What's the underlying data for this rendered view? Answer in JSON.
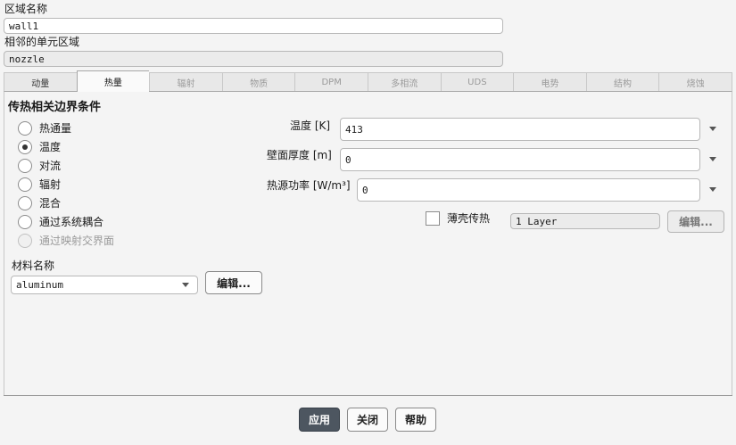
{
  "zone": {
    "name_label": "区域名称",
    "name_value": "wall1",
    "adjacent_label": "相邻的单元区域",
    "adjacent_value": "nozzle"
  },
  "tabs": [
    "动量",
    "热量",
    "辐射",
    "物质",
    "DPM",
    "多相流",
    "UDS",
    "电势",
    "结构",
    "烧蚀"
  ],
  "active_tab": "热量",
  "thermal": {
    "section_title": "传热相关边界条件",
    "options": [
      "热通量",
      "温度",
      "对流",
      "辐射",
      "混合",
      "通过系统耦合",
      "通过映射交界面"
    ],
    "selected": "温度",
    "disabled_option": "通过映射交界面",
    "temperature_label": "温度 [K]",
    "temperature_value": "413",
    "wall_thickness_label": "壁面厚度 [m]",
    "wall_thickness_value": "0",
    "heat_source_label": "热源功率 [W/m³]",
    "heat_source_value": "0",
    "shell_conduction_label": "薄壳传热",
    "layers_value": "1 Layer",
    "edit_layers_label": "编辑...",
    "material_label": "材料名称",
    "material_value": "aluminum",
    "edit_material_label": "编辑..."
  },
  "footer": {
    "apply": "应用",
    "close": "关闭",
    "help": "帮助"
  }
}
